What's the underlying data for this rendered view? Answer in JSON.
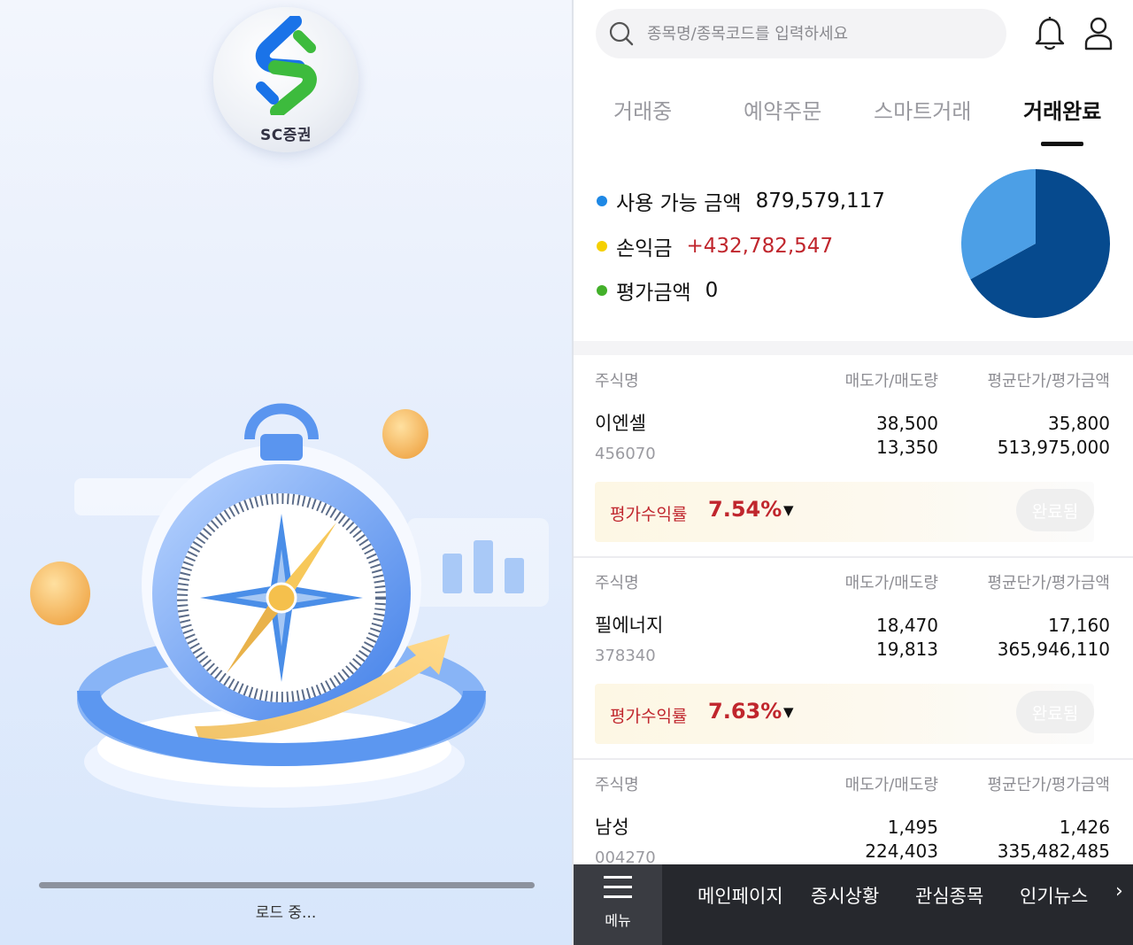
{
  "loading": {
    "brand_text": "SC증권",
    "status_text": "로드 중..."
  },
  "search": {
    "placeholder": "종목명/종목코드를 입력하세요"
  },
  "icons": {
    "search": "search-icon",
    "notification": "bell-icon",
    "profile": "user-icon",
    "menu": "hamburger-icon",
    "caret": "caret-down-icon",
    "next": "chevron-right-icon"
  },
  "tabs": [
    {
      "label": "거래중",
      "active": false
    },
    {
      "label": "예약주문",
      "active": false
    },
    {
      "label": "스마트거래",
      "active": false
    },
    {
      "label": "거래완료",
      "active": true
    }
  ],
  "summary": {
    "available": {
      "label": "사용 가능 금액",
      "value": "879,579,117",
      "color": "#1e88e5"
    },
    "profit": {
      "label": "손익금",
      "value": "+432,782,547",
      "color": "#f5d000"
    },
    "valuation": {
      "label": "평가금액",
      "value": "0",
      "color": "#43b02a"
    }
  },
  "chart_data": {
    "type": "pie",
    "slices": [
      {
        "value": 879579117,
        "color": "#064a8e"
      },
      {
        "value": 432782547,
        "color": "#4c9fe6"
      }
    ]
  },
  "columns": {
    "name": "주식명",
    "sell": "매도가/매도량",
    "avg": "평균단가/평가금액"
  },
  "stocks": [
    {
      "name": "이엔셀",
      "code": "456070",
      "sell_price": "38,500",
      "sell_qty": "13,350",
      "avg_price": "35,800",
      "eval_amount": "513,975,000",
      "rate_label": "평가수익률",
      "rate": "7.54%",
      "status": "완료됨"
    },
    {
      "name": "필에너지",
      "code": "378340",
      "sell_price": "18,470",
      "sell_qty": "19,813",
      "avg_price": "17,160",
      "eval_amount": "365,946,110",
      "rate_label": "평가수익률",
      "rate": "7.63%",
      "status": "완료됨"
    },
    {
      "name": "남성",
      "code": "004270",
      "sell_price": "1,495",
      "sell_qty": "224,403",
      "avg_price": "1,426",
      "eval_amount": "335,482,485"
    }
  ],
  "nav": {
    "menu_label": "메뉴",
    "items": [
      "메인페이지",
      "증시상황",
      "관심종목",
      "인기뉴스"
    ]
  }
}
